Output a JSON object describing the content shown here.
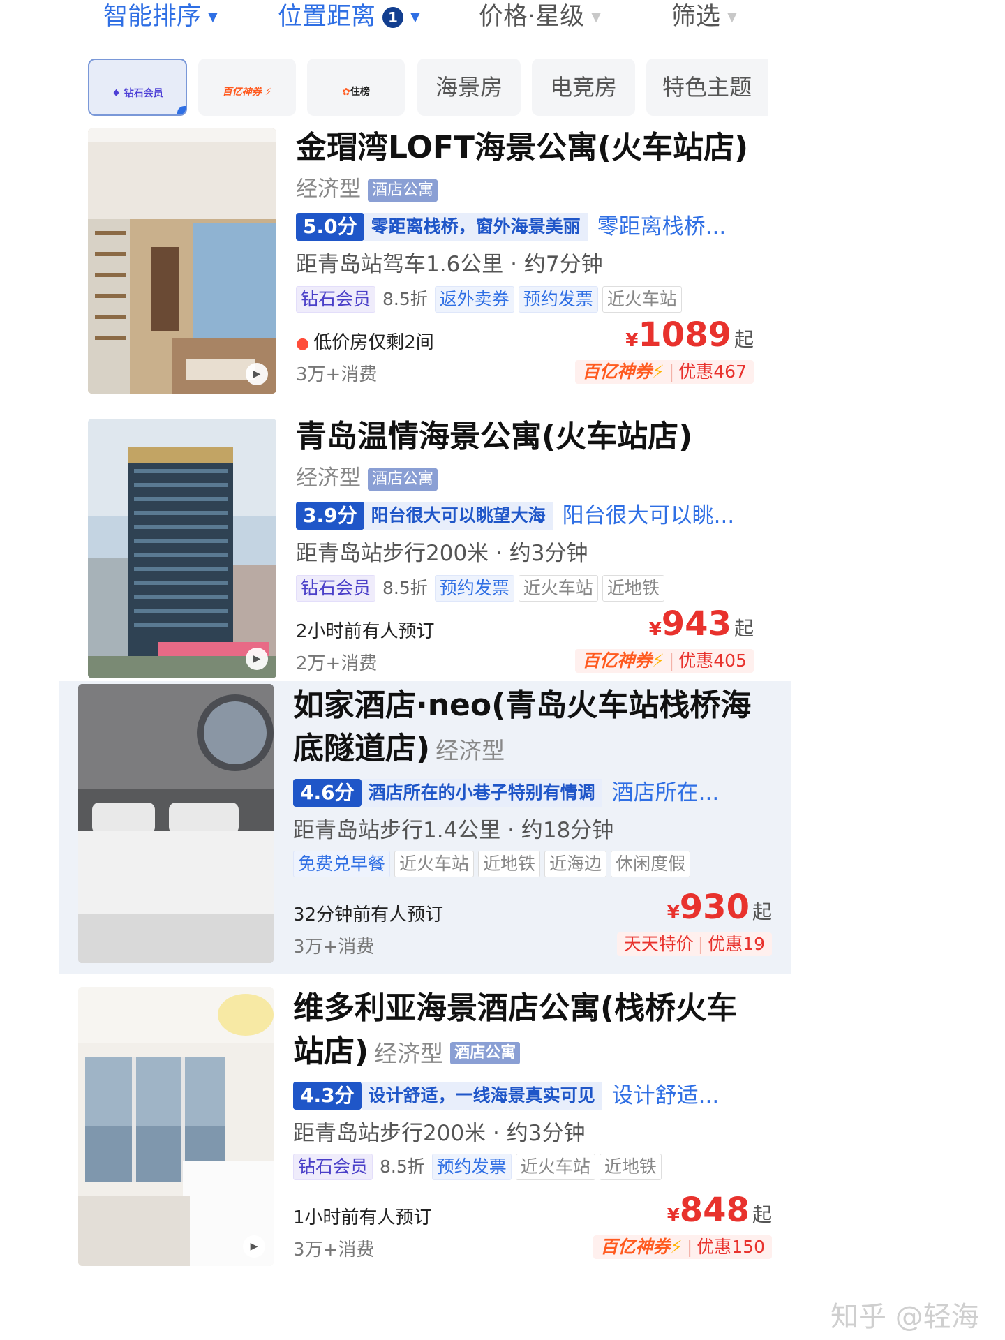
{
  "sort_bar": {
    "smart_sort": "智能排序",
    "location_distance": "位置距离",
    "location_count": "1",
    "price_star": "价格·星级",
    "filter": "筛选"
  },
  "quick_filters": {
    "diamond_member_logo": "钻石会员",
    "baiyi_logo": "百亿神券",
    "zhubang_logo": "住榜",
    "chips": [
      "海景房",
      "电竞房",
      "特色主题"
    ]
  },
  "hotels": [
    {
      "name": "金瑁湾LOFT海景公寓(火车站店)",
      "category": "经济型",
      "type_tag": "酒店公寓",
      "score": "5.0分",
      "review_highlight": "零距离栈桥，窗外海景美丽",
      "review_more": "零距离栈桥...",
      "distance": "距青岛站驾车1.6公里 · 约7分钟",
      "badges": [
        "钻石会员",
        "8.5折",
        "返外卖券",
        "预约发票",
        "近火车站"
      ],
      "urgency": "低价房仅剩2间",
      "sales": "3万+消费",
      "currency": "¥",
      "price": "1089",
      "price_suffix": "起",
      "promo_brand": "百亿神券",
      "promo_discount": "优惠467"
    },
    {
      "name": "青岛温情海景公寓(火车站店)",
      "category": "经济型",
      "type_tag": "酒店公寓",
      "score": "3.9分",
      "review_highlight": "阳台很大可以眺望大海",
      "review_more": "阳台很大可以眺...",
      "distance": "距青岛站步行200米 · 约3分钟",
      "badges": [
        "钻石会员",
        "8.5折",
        "预约发票",
        "近火车站",
        "近地铁"
      ],
      "urgency": "2小时前有人预订",
      "sales": "2万+消费",
      "currency": "¥",
      "price": "943",
      "price_suffix": "起",
      "promo_brand": "百亿神券",
      "promo_discount": "优惠405"
    },
    {
      "name": "如家酒店·neo(青岛火车站栈桥海底隧道店)",
      "category": "经济型",
      "score": "4.6分",
      "review_highlight": "酒店所在的小巷子特别有情调",
      "review_more": "酒店所在...",
      "distance": "距青岛站步行1.4公里 · 约18分钟",
      "badges": [
        "免费兑早餐",
        "近火车站",
        "近地铁",
        "近海边",
        "休闲度假"
      ],
      "urgency": "32分钟前有人预订",
      "sales": "3万+消费",
      "currency": "¥",
      "price": "930",
      "price_suffix": "起",
      "promo_brand": "天天特价",
      "promo_discount": "优惠19"
    },
    {
      "name": "维多利亚海景酒店公寓(栈桥火车站店)",
      "category": "经济型",
      "type_tag": "酒店公寓",
      "score": "4.3分",
      "review_highlight": "设计舒适，一线海景真实可见",
      "review_more": "设计舒适...",
      "distance": "距青岛站步行200米 · 约3分钟",
      "badges": [
        "钻石会员",
        "8.5折",
        "预约发票",
        "近火车站",
        "近地铁"
      ],
      "urgency": "1小时前有人预订",
      "sales": "3万+消费",
      "currency": "¥",
      "price": "848",
      "price_suffix": "起",
      "promo_brand": "百亿神券",
      "promo_discount": "优惠150"
    }
  ],
  "watermark": "知乎 @轻海"
}
